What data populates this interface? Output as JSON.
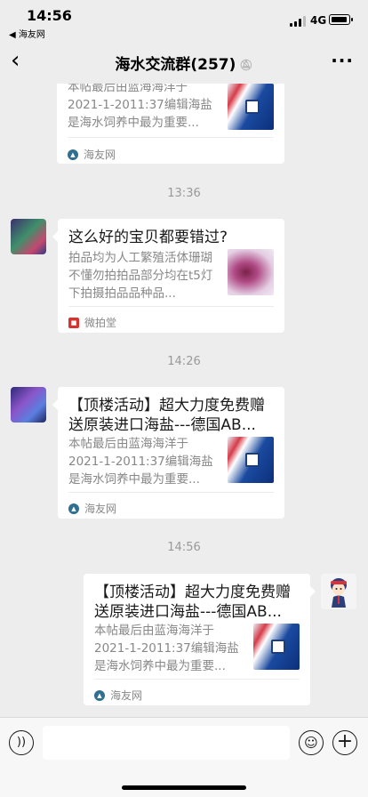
{
  "status_bar": {
    "time": "14:56",
    "back_app": "◀ 海友网",
    "network": "4G"
  },
  "nav": {
    "title": "海水交流群(257)",
    "mute_icon": "bell-off-icon",
    "more_icon": "more-icon"
  },
  "messages": [
    {
      "type": "card",
      "sender": "other",
      "description": "本帖最后由蓝海海洋于2021-1-2011:37编辑海盐是海水饲养中最为重要...",
      "source": "海友网"
    },
    {
      "type": "time",
      "text": "13:36"
    },
    {
      "type": "card",
      "sender": "other",
      "title": "这么好的宝贝都要错过?",
      "description": "拍品均为人工繁殖活体珊瑚不懂勿拍拍品部分均在t5灯下拍摄拍品品种品...",
      "source": "微拍堂"
    },
    {
      "type": "time",
      "text": "14:26"
    },
    {
      "type": "card",
      "sender": "other",
      "title": "【顶楼活动】超大力度免费赠送原装进口海盐---德国AB...",
      "description": "本帖最后由蓝海海洋于2021-1-2011:37编辑海盐是海水饲养中最为重要...",
      "source": "海友网"
    },
    {
      "type": "time",
      "text": "14:56"
    },
    {
      "type": "card",
      "sender": "me",
      "title": "【顶楼活动】超大力度免费赠送原装进口海盐---德国AB...",
      "description": "本帖最后由蓝海海洋于2021-1-2011:37编辑海盐是海水饲养中最为重要...",
      "source": "海友网"
    }
  ],
  "input_bar": {
    "voice_icon": "voice-icon",
    "emoji_icon": "emoji-icon",
    "plus_icon": "plus-icon"
  }
}
